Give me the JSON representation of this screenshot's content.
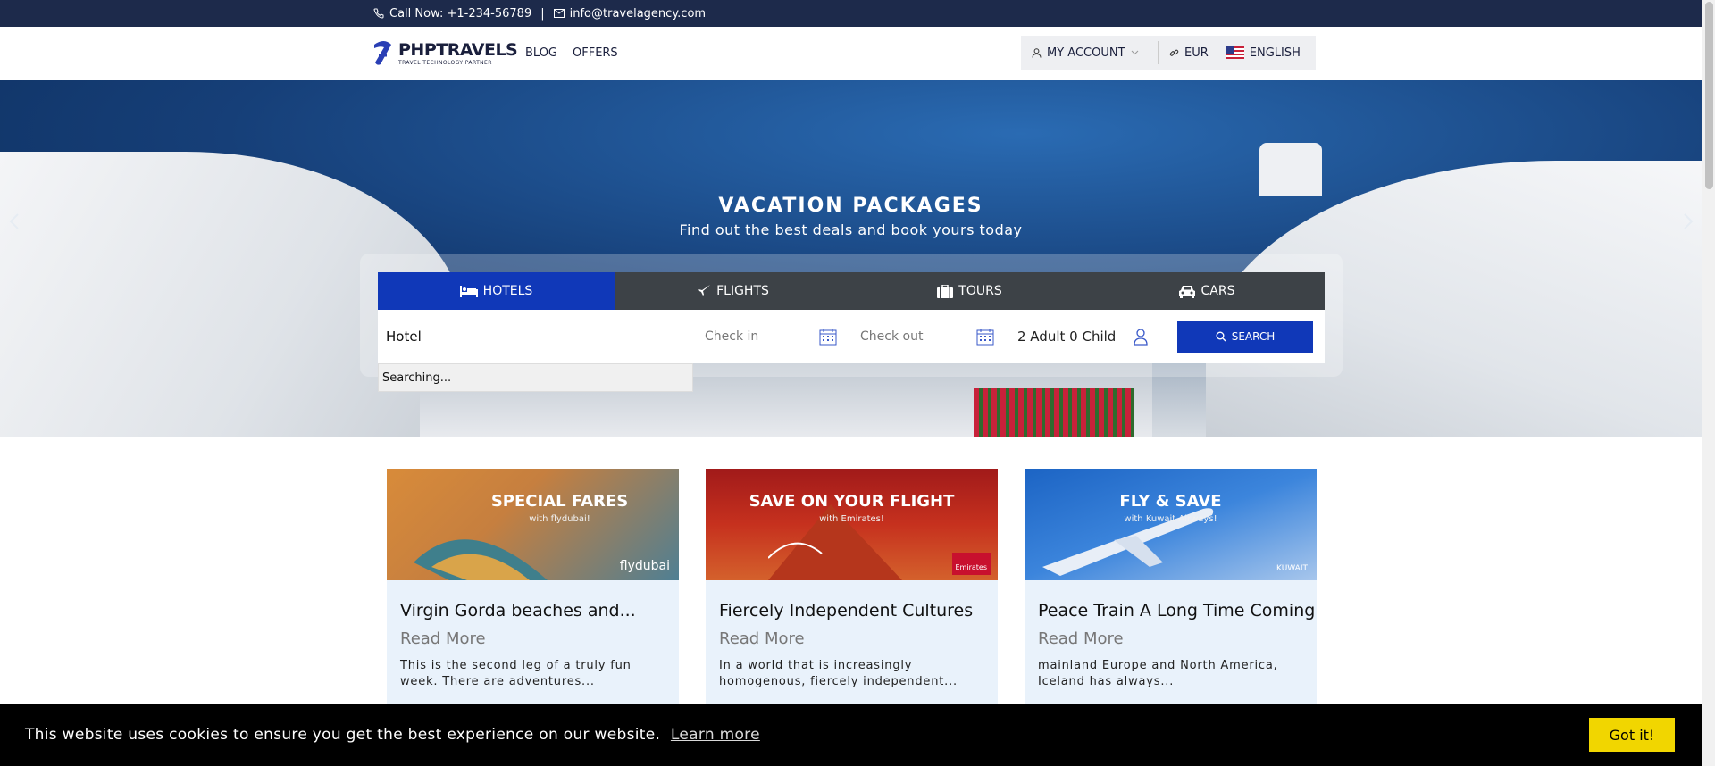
{
  "topbar": {
    "phone": "Call Now: +1-234-56789",
    "separator": "|",
    "email": "info@travelagency.com"
  },
  "header": {
    "logo_main": "PHPTRAVELS",
    "logo_tag": "TRAVEL TECHNOLOGY PARTNER",
    "nav": [
      "BLOG",
      "OFFERS"
    ],
    "account": "MY ACCOUNT",
    "currency": "EUR",
    "language": "ENGLISH"
  },
  "hero": {
    "title": "VACATION PACKAGES",
    "subtitle": "Find out the best deals and book yours today"
  },
  "search": {
    "tabs": [
      {
        "label": "HOTELS",
        "icon": "bed-icon",
        "active": true
      },
      {
        "label": "FLIGHTS",
        "icon": "plane-icon",
        "active": false
      },
      {
        "label": "TOURS",
        "icon": "suitcase-icon",
        "active": false
      },
      {
        "label": "CARS",
        "icon": "car-icon",
        "active": false
      }
    ],
    "hotel_value": "Hotel",
    "checkin_placeholder": "Check in",
    "checkout_placeholder": "Check out",
    "guests": "2 Adult 0 Child",
    "button": "SEARCH",
    "dropdown_text": "Searching..."
  },
  "cards": [
    {
      "banner_title": "SPECIAL FARES",
      "banner_sub": "with flydubai!",
      "brand": "flydubai",
      "title": "Virgin Gorda beaches and...",
      "read_more": "Read More",
      "desc": "This is the second leg of a truly fun week. There are adventures..."
    },
    {
      "banner_title": "SAVE ON YOUR FLIGHT",
      "banner_sub": "with Emirates!",
      "brand": "Emirates",
      "title": "Fiercely Independent Cultures",
      "read_more": "Read More",
      "desc": "In a world that is increasingly homogenous, fiercely independent..."
    },
    {
      "banner_title": "FLY & SAVE",
      "banner_sub": "with Kuwait Airways!",
      "brand": "KUWAIT",
      "title": "Peace Train A Long Time Coming",
      "read_more": "Read More",
      "desc": " mainland Europe and North America, Iceland has always..."
    }
  ],
  "cookie": {
    "message": "This website uses cookies to ensure you get the best experience on our website.",
    "learn_more": "Learn more",
    "button": "Got it!"
  },
  "colors": {
    "topbar": "#1d2a4b",
    "accent": "#1038b8",
    "cookie_button": "#f1d600"
  }
}
